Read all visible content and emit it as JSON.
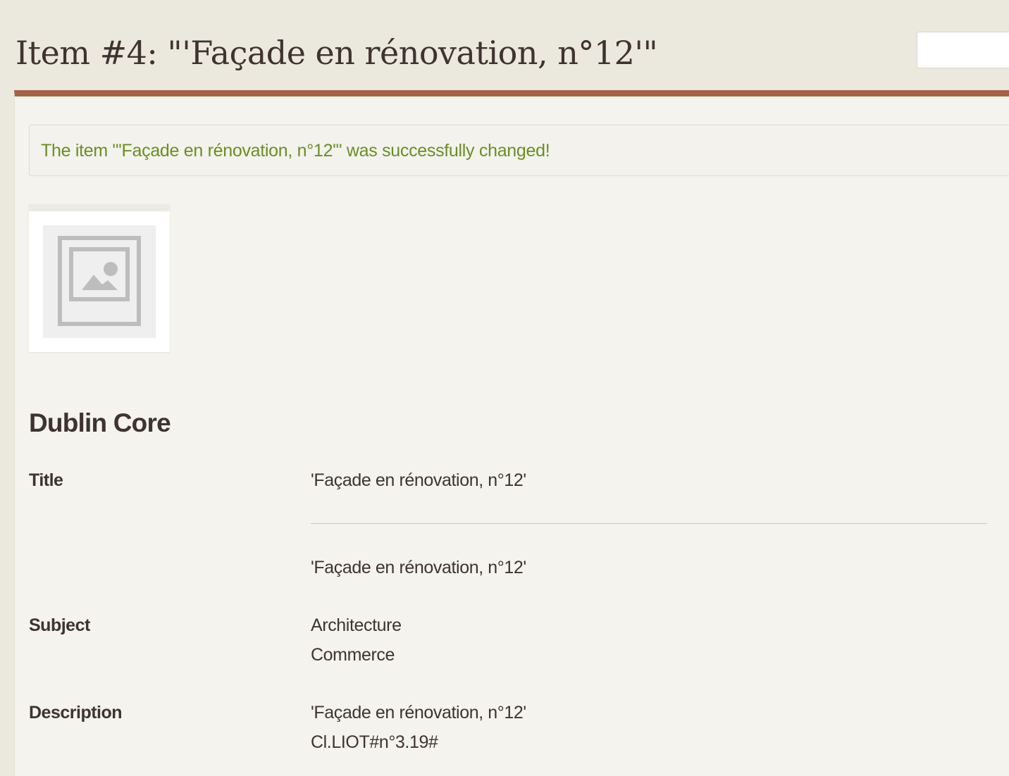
{
  "header": {
    "title": "Item #4: \"'Façade en rénovation, n°12'\"",
    "search_value": ""
  },
  "flash": {
    "message": "The item \"'Façade en rénovation, n°12'\" was successfully changed!",
    "color": "#6b8e23"
  },
  "thumbnail": {
    "icon": "image-placeholder-icon"
  },
  "dublin_core": {
    "heading": "Dublin Core",
    "fields": [
      {
        "label": "Title",
        "values": [
          "'Façade en rénovation, n°12'",
          "'Façade en rénovation, n°12'"
        ]
      },
      {
        "label": "Subject",
        "values": [
          "Architecture",
          "Commerce"
        ]
      },
      {
        "label": "Description",
        "values": [
          "'Façade en rénovation, n°12'",
          "Cl.LIOT#n°3.19#"
        ]
      }
    ]
  },
  "colors": {
    "accent_bar": "#a4624a",
    "page_background": "#ebe8de",
    "content_background": "#f4f3ee",
    "text": "#3f3330"
  }
}
